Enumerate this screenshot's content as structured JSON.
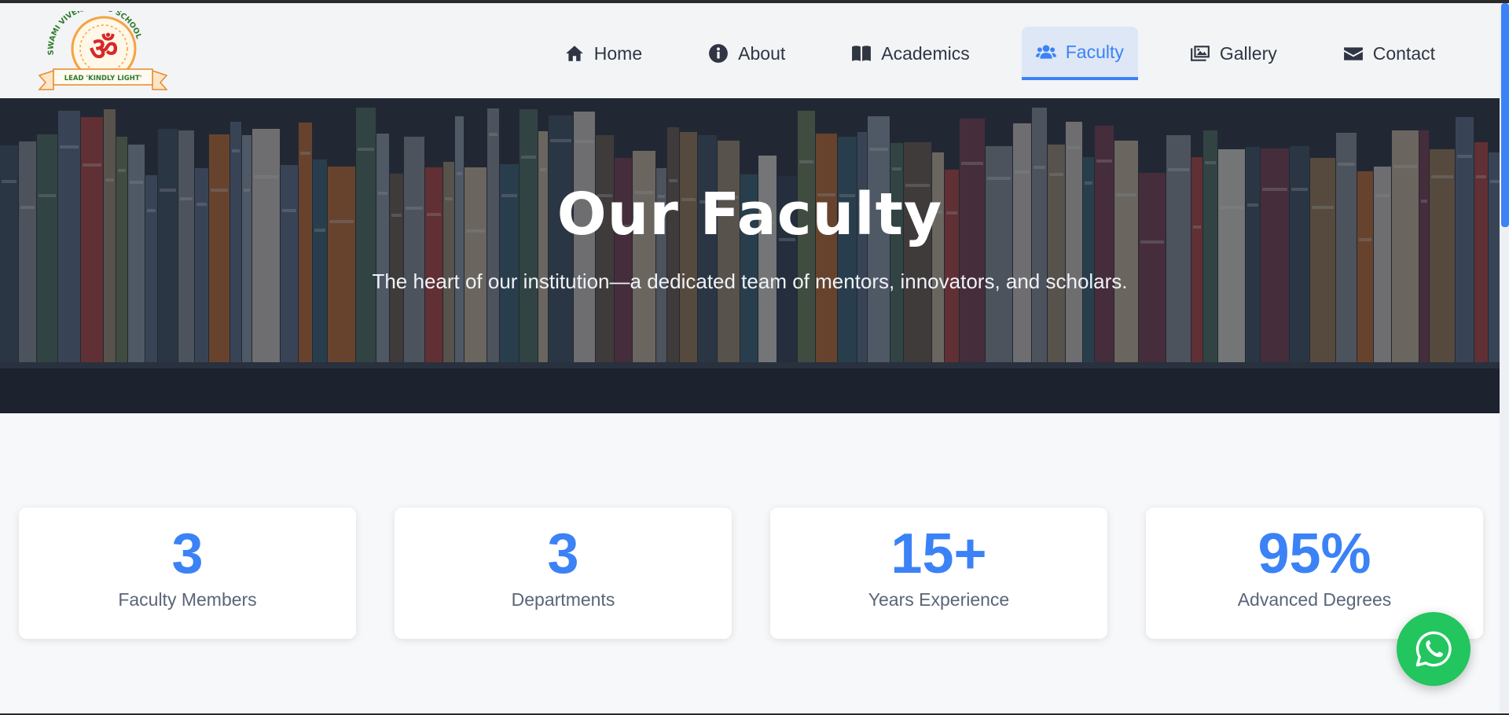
{
  "brand": {
    "school_name": "SWAMI VIVEKANAND SCHOOL",
    "motto": "LEAD 'KINDLY LIGHT'"
  },
  "nav": {
    "items": [
      {
        "label": "Home",
        "icon": "home-icon"
      },
      {
        "label": "About",
        "icon": "info-icon"
      },
      {
        "label": "Academics",
        "icon": "book-icon"
      },
      {
        "label": "Faculty",
        "icon": "users-icon",
        "active": true
      },
      {
        "label": "Gallery",
        "icon": "images-icon"
      },
      {
        "label": "Contact",
        "icon": "envelope-icon"
      }
    ]
  },
  "hero": {
    "title": "Our Faculty",
    "subtitle": "The heart of our institution—a dedicated team of mentors, innovators, and scholars."
  },
  "stats": [
    {
      "value": "3",
      "label": "Faculty Members"
    },
    {
      "value": "3",
      "label": "Departments"
    },
    {
      "value": "15+",
      "label": "Years Experience"
    },
    {
      "value": "95%",
      "label": "Advanced Degrees"
    }
  ],
  "colors": {
    "accent": "#3b82f6",
    "nav_active_bg": "#dde7f5",
    "whatsapp": "#22c55e"
  },
  "floating": {
    "icon": "whatsapp-icon"
  }
}
